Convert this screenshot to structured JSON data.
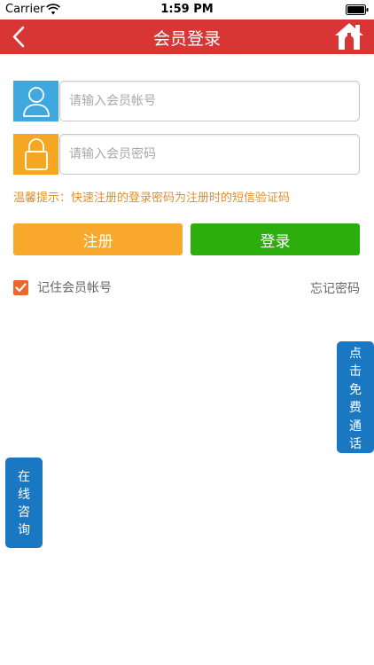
{
  "status_bar": {
    "carrier": "Carrier",
    "time": "1:59 PM",
    "icons": [
      "wifi-icon",
      "battery-icon"
    ]
  },
  "nav": {
    "title": "会员登录",
    "back_icon": "chevron-left-icon",
    "home_icon": "home-icon",
    "background": "#d83535"
  },
  "form": {
    "username_placeholder": "请输入会员帐号",
    "username_value": "",
    "username_icon": "user-icon",
    "password_placeholder": "请输入会员密码",
    "password_value": "",
    "password_icon": "lock-icon",
    "tip": "温馨提示：快速注册的登录密码为注册时的短信验证码"
  },
  "buttons": {
    "register": "注册",
    "login": "登录"
  },
  "options": {
    "remember_label": "记住会员帐号",
    "remember_checked": true,
    "forgot_label": "忘记密码"
  },
  "floating": {
    "call": "点击免费通话",
    "consult": "在线咨询"
  },
  "colors": {
    "accent_red": "#d83535",
    "register_orange": "#f8a82a",
    "login_green": "#2cae0d",
    "float_blue": "#1a78c2",
    "user_blue": "#3fa9df",
    "lock_orange": "#f5a623",
    "tip_orange": "#e0902a"
  }
}
